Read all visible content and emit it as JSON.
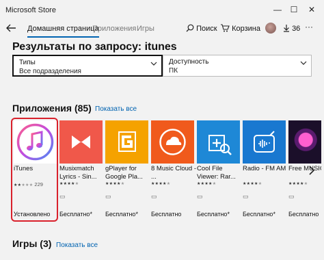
{
  "window": {
    "title": "Microsoft Store",
    "minimize": "—",
    "maximize": "☐",
    "close": "✕"
  },
  "nav": {
    "home": "Домашняя страница",
    "apps": "Приложения",
    "games": "Игры",
    "search": "Поиск",
    "cart": "Корзина",
    "downloads": "36"
  },
  "heading": "Результаты по запросу:  itunes",
  "filters": [
    {
      "label": "Типы",
      "value": "Все подразделения"
    },
    {
      "label": "Доступность",
      "value": "ПК"
    }
  ],
  "apps_section": {
    "title": "Приложения (85)",
    "show_all": "Показать все"
  },
  "games_section": {
    "title": "Игры (3)",
    "show_all": "Показать все"
  },
  "apps": [
    {
      "name": "iTunes",
      "rating": 2,
      "count": "229",
      "status": "Установлено"
    },
    {
      "name": "Musixmatch Lyrics - Sin...",
      "rating": 4,
      "count": "",
      "status": "Бесплатно*"
    },
    {
      "name": "gPlayer for Google Pla...",
      "rating": 4,
      "count": "",
      "status": "Бесплатно*"
    },
    {
      "name": "8 Music Cloud - ...",
      "rating": 4,
      "count": "",
      "status": "Бесплатно"
    },
    {
      "name": "Cool File Viewer: Rar...",
      "rating": 4,
      "count": "",
      "status": "Бесплатно*"
    },
    {
      "name": "Radio - FM AM",
      "rating": 4,
      "count": "",
      "status": "Бесплатно*"
    },
    {
      "name": "Free MUSIC",
      "rating": 4,
      "count": "",
      "status": "Бесплатно"
    }
  ],
  "colors": {
    "accent": "#0063b1",
    "highlight": "#d9202b",
    "musixmatch": "#f0584a",
    "gplayer": "#f5a200",
    "eightmusic": "#f05a1c",
    "coolfile": "#1e88d6",
    "radio": "#1978d0"
  }
}
